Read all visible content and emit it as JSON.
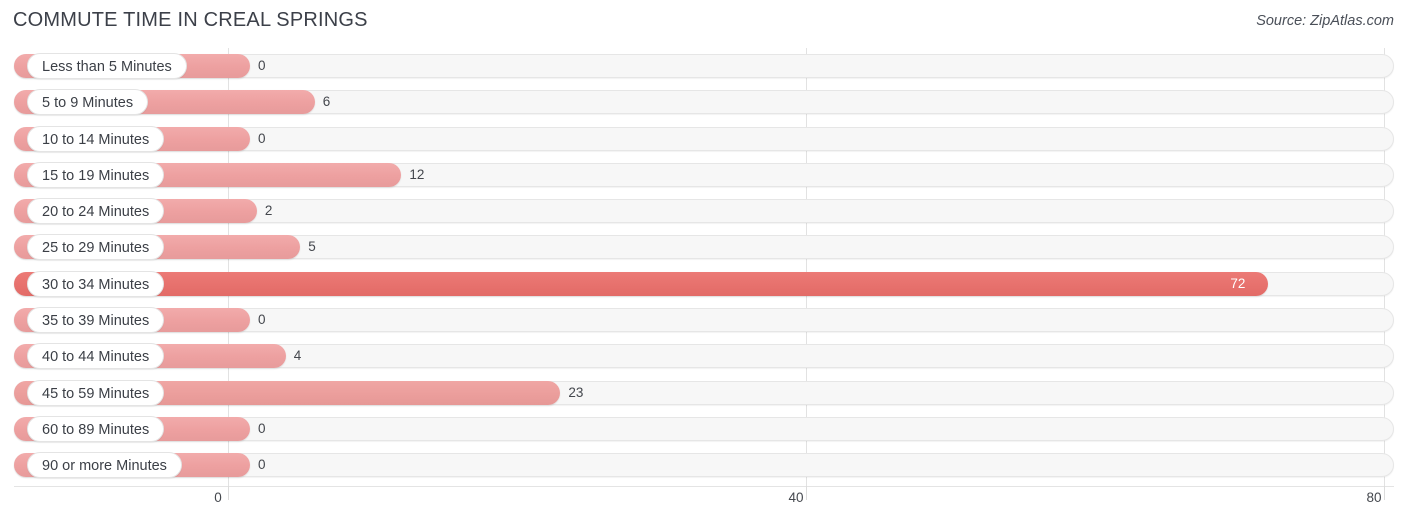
{
  "header": {
    "title": "COMMUTE TIME IN CREAL SPRINGS",
    "source": "Source: ZipAtlas.com"
  },
  "chart_data": {
    "type": "bar",
    "orientation": "horizontal",
    "title": "COMMUTE TIME IN CREAL SPRINGS",
    "xlabel": "",
    "ylabel": "",
    "xlim": [
      0,
      80
    ],
    "ticks": [
      0,
      40,
      80
    ],
    "tick_labels": [
      "0",
      "40",
      "80"
    ],
    "grid": true,
    "legend": "none",
    "categories": [
      "Less than 5 Minutes",
      "5 to 9 Minutes",
      "10 to 14 Minutes",
      "15 to 19 Minutes",
      "20 to 24 Minutes",
      "25 to 29 Minutes",
      "30 to 34 Minutes",
      "35 to 39 Minutes",
      "40 to 44 Minutes",
      "45 to 59 Minutes",
      "60 to 89 Minutes",
      "90 or more Minutes"
    ],
    "values": [
      0,
      6,
      0,
      12,
      2,
      5,
      72,
      0,
      4,
      23,
      0,
      0
    ],
    "value_labels": [
      "0",
      "6",
      "0",
      "12",
      "2",
      "5",
      "72",
      "0",
      "4",
      "23",
      "0",
      "0"
    ],
    "colors": {
      "bar_light": "#eda0a0",
      "bar_mid": "#eb9e9c",
      "bar_strong": "#e7716d",
      "track": "#f7f7f7",
      "gridline": "#e2e2e2",
      "text": "#44474d"
    }
  },
  "axis": {
    "ticks": [
      {
        "label": "0"
      },
      {
        "label": "40"
      },
      {
        "label": "80"
      }
    ]
  }
}
